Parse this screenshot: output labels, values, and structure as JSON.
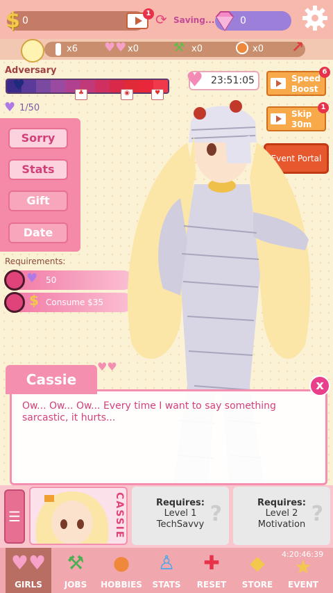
{
  "topbar": {
    "cash": "0",
    "video_badge": "1",
    "saving": "Saving...",
    "gems": "0"
  },
  "resources": {
    "item1": "x6",
    "item2": "x0",
    "item3": "x0",
    "item4": "x0"
  },
  "adversary": {
    "label": "Adversary",
    "affection": "1/50"
  },
  "timer": "23:51:05",
  "boosts": {
    "speed": {
      "label": "Speed Boost",
      "badge": "6"
    },
    "skip": {
      "label": "Skip 30m",
      "badge": "1"
    }
  },
  "event_portal": "Event Portal",
  "menu": {
    "items": [
      "Sorry",
      "Stats",
      "Gift",
      "Date"
    ]
  },
  "requirements": {
    "label": "Requirements:",
    "items": [
      {
        "text": "50"
      },
      {
        "text": "Consume $35"
      }
    ]
  },
  "dialog": {
    "name": "Cassie",
    "text": "Ow... Ow... Ow... Every time I want to say something sarcastic, it hurts...",
    "close": "x"
  },
  "girls": {
    "current": "CASSIE",
    "locked": [
      {
        "title": "Requires:",
        "line1": "Level 1",
        "line2": "TechSavvy"
      },
      {
        "title": "Requires:",
        "line1": "Level 2",
        "line2": "Motivation"
      }
    ]
  },
  "nav": {
    "items": [
      "GIRLS",
      "JOBS",
      "HOBBIES",
      "STATS",
      "RESET",
      "STORE",
      "EVENT"
    ],
    "event_timer": "4:20:46:39"
  },
  "colors": {
    "accent_pink": "#f58fb0",
    "menu_pink": "#f48aa8",
    "orange": "#f8a94a"
  }
}
